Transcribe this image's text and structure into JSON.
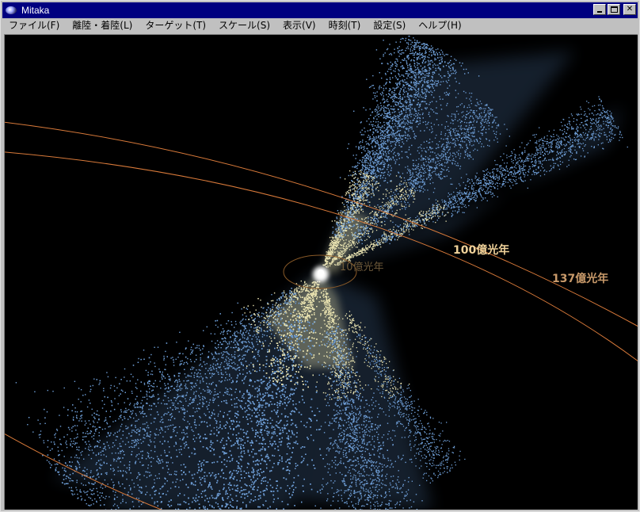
{
  "window": {
    "title": "Mitaka",
    "buttons": {
      "minimize": "minimize",
      "maximize": "maximize",
      "close": "✕"
    }
  },
  "menu": [
    {
      "label": "ファイル(F)"
    },
    {
      "label": "離陸・着陸(L)"
    },
    {
      "label": "ターゲット(T)"
    },
    {
      "label": "スケール(S)"
    },
    {
      "label": "表示(V)"
    },
    {
      "label": "時刻(T)"
    },
    {
      "label": "設定(S)"
    },
    {
      "label": "ヘルプ(H)"
    }
  ],
  "scene": {
    "rings": [
      {
        "label": "10億光年",
        "color": "#8a5a28"
      },
      {
        "label": "100億光年",
        "color": "#d97a3a"
      },
      {
        "label": "137億光年",
        "color": "#d97a3a"
      }
    ],
    "colors": {
      "background": "#000000",
      "galaxy_blue": "#6f9fd8",
      "galaxy_yellow": "#e8e2b0",
      "core": "#ffffff"
    }
  }
}
